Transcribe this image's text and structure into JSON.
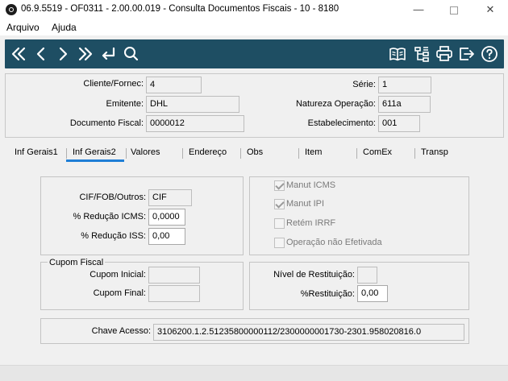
{
  "window": {
    "title": "06.9.5519 - OF0311 - 2.00.00.019 - Consulta Documentos Fiscais - 10 - 8180",
    "minimize_glyph": "—",
    "close_glyph": "✕"
  },
  "menu": {
    "items": [
      "Arquivo",
      "Ajuda"
    ]
  },
  "toolbar": {
    "icons": [
      "first-icon",
      "previous-icon",
      "next-icon",
      "last-icon",
      "return-icon",
      "search-icon",
      "book-icon",
      "tree-icon",
      "print-icon",
      "exit-icon",
      "help-icon"
    ],
    "color": "#1e4e63"
  },
  "header": {
    "cliente_label": "Cliente/Fornec:",
    "cliente_value": "4",
    "emitente_label": "Emitente:",
    "emitente_value": "DHL",
    "documento_label": "Documento Fiscal:",
    "documento_value": "0000012",
    "serie_label": "Série:",
    "serie_value": "1",
    "natureza_label": "Natureza Operação:",
    "natureza_value": "611a",
    "estabelecimento_label": "Estabelecimento:",
    "estabelecimento_value": "001"
  },
  "tabs": [
    "Inf Gerais1",
    "Inf Gerais2",
    "Valores",
    "Endereço",
    "Obs",
    "Item",
    "ComEx",
    "Transp"
  ],
  "active_tab": "Inf Gerais2",
  "active_color": "#1f7ed6",
  "form": {
    "cif_label": "CIF/FOB/Outros:",
    "cif_value": "CIF",
    "red_icms_label": "% Redução ICMS:",
    "red_icms_value": "0,0000",
    "red_iss_label": "% Redução ISS:",
    "red_iss_value": "0,00",
    "manut_icms_label": "Manut ICMS",
    "manut_ipi_label": "Manut IPI",
    "retem_irrf_label": "Retém IRRF",
    "operacao_label": "Operação não Efetivada",
    "cupom_group": "Cupom Fiscal",
    "cupom_inicial_label": "Cupom Inicial:",
    "cupom_inicial_value": "",
    "cupom_final_label": "Cupom Final:",
    "cupom_final_value": "",
    "nivel_label": "Nível de Restituição:",
    "nivel_value": "",
    "restituicao_label": "%Restituição:",
    "restituicao_value": "0,00",
    "chave_label": "Chave Acesso:",
    "chave_value": "3106200.1.2.51235800000112/2300000001730-2301.958020816.0"
  }
}
